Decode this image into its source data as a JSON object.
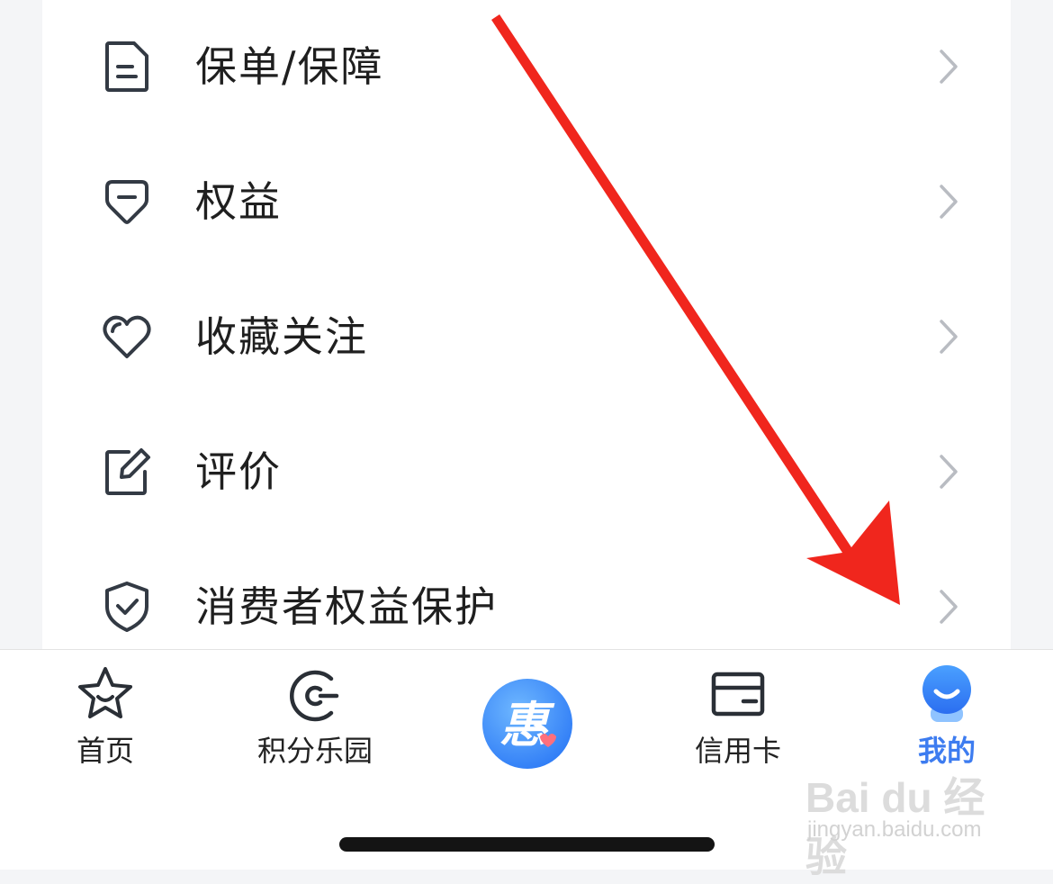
{
  "menu": {
    "items": [
      {
        "label": "保单/保障",
        "icon": "document-icon"
      },
      {
        "label": "权益",
        "icon": "badge-icon"
      },
      {
        "label": "收藏关注",
        "icon": "heart-icon"
      },
      {
        "label": "评价",
        "icon": "edit-icon"
      },
      {
        "label": "消费者权益保护",
        "icon": "shield-check-icon"
      }
    ]
  },
  "tabbar": {
    "tabs": [
      {
        "label": "首页",
        "icon": "star-icon"
      },
      {
        "label": "积分乐园",
        "icon": "points-icon"
      },
      {
        "label": "",
        "icon": "hui-logo-icon",
        "glyph": "惠"
      },
      {
        "label": "信用卡",
        "icon": "credit-card-icon"
      },
      {
        "label": "我的",
        "icon": "mine-avatar-icon",
        "active": true
      }
    ]
  },
  "colors": {
    "accent": "#3d7cf0",
    "annotation_arrow": "#f0261d",
    "text": "#1f1f1f",
    "icon_stroke": "#333a44"
  },
  "watermark": {
    "logo": "Bai du 经验",
    "sub": "jingyan.baidu.com"
  }
}
